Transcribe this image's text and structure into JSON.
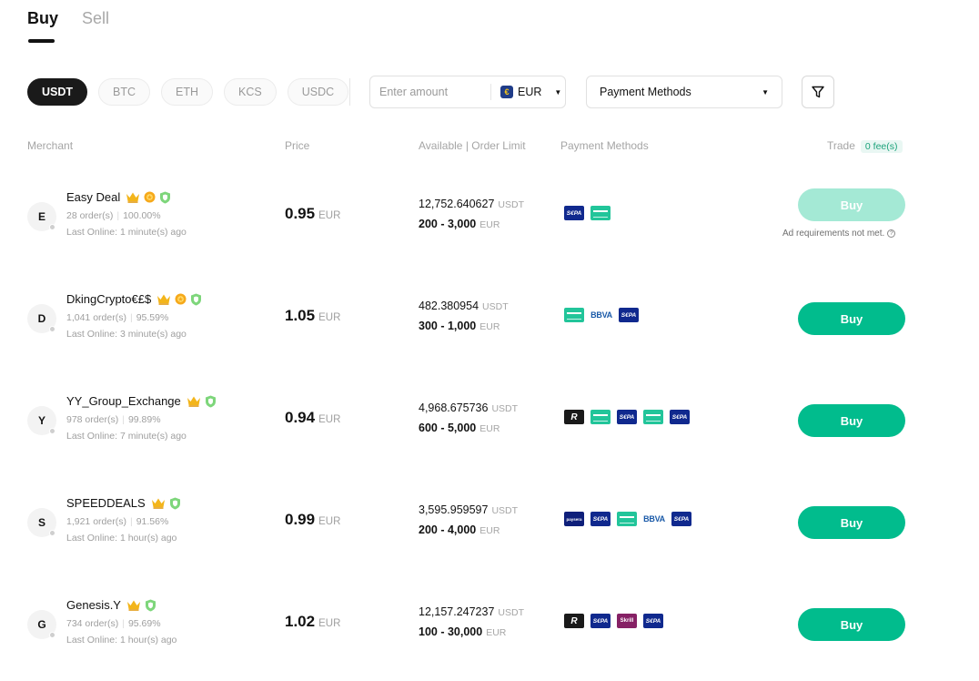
{
  "tabs": [
    {
      "label": "Buy",
      "active": true
    },
    {
      "label": "Sell",
      "active": false
    }
  ],
  "coins": [
    {
      "label": "USDT",
      "active": true
    },
    {
      "label": "BTC",
      "active": false
    },
    {
      "label": "ETH",
      "active": false
    },
    {
      "label": "KCS",
      "active": false
    },
    {
      "label": "USDC",
      "active": false
    }
  ],
  "amount": {
    "placeholder": "Enter amount",
    "value": "",
    "currency": "EUR",
    "currency_icon": "€"
  },
  "payment_filter": {
    "label": "Payment Methods"
  },
  "table": {
    "headers": {
      "merchant": "Merchant",
      "price": "Price",
      "available": "Available | Order Limit",
      "payment": "Payment Methods",
      "trade": "Trade",
      "fee": "0 fee(s)"
    },
    "rows": [
      {
        "initial": "E",
        "name": "Easy Deal",
        "badges": [
          "crown",
          "gold",
          "shield"
        ],
        "orders": "28 order(s)",
        "rate": "100.00%",
        "online": "Last Online: 1 minute(s) ago",
        "price": "0.95",
        "price_cur": "EUR",
        "available": "12,752.640627",
        "available_unit": "USDT",
        "limit": "200 - 3,000",
        "limit_unit": "EUR",
        "payments": [
          {
            "type": "sepa",
            "label": "S€PA"
          },
          {
            "type": "card",
            "label": ""
          }
        ],
        "buy_label": "Buy",
        "disabled": true,
        "note": "Ad requirements not met."
      },
      {
        "initial": "D",
        "name": "DkingCrypto€£$",
        "badges": [
          "crown",
          "gold",
          "shield"
        ],
        "orders": "1,041 order(s)",
        "rate": "95.59%",
        "online": "Last Online: 3 minute(s) ago",
        "price": "1.05",
        "price_cur": "EUR",
        "available": "482.380954",
        "available_unit": "USDT",
        "limit": "300 - 1,000",
        "limit_unit": "EUR",
        "payments": [
          {
            "type": "card",
            "label": ""
          },
          {
            "type": "bbva",
            "label": "BBVA"
          },
          {
            "type": "sepa",
            "label": "S€PA"
          }
        ],
        "buy_label": "Buy",
        "disabled": false,
        "note": ""
      },
      {
        "initial": "Y",
        "name": "YY_Group_Exchange",
        "badges": [
          "crown",
          "shield"
        ],
        "orders": "978 order(s)",
        "rate": "99.89%",
        "online": "Last Online: 7 minute(s) ago",
        "price": "0.94",
        "price_cur": "EUR",
        "available": "4,968.675736",
        "available_unit": "USDT",
        "limit": "600 - 5,000",
        "limit_unit": "EUR",
        "payments": [
          {
            "type": "revolut",
            "label": "R"
          },
          {
            "type": "card",
            "label": ""
          },
          {
            "type": "sepa",
            "label": "S€PA"
          },
          {
            "type": "card",
            "label": ""
          },
          {
            "type": "sepa",
            "label": "S€PA"
          }
        ],
        "buy_label": "Buy",
        "disabled": false,
        "note": ""
      },
      {
        "initial": "S",
        "name": "SPEEDDEALS",
        "badges": [
          "crown",
          "shield"
        ],
        "orders": "1,921 order(s)",
        "rate": "91.56%",
        "online": "Last Online: 1 hour(s) ago",
        "price": "0.99",
        "price_cur": "EUR",
        "available": "3,595.959597",
        "available_unit": "USDT",
        "limit": "200 - 4,000",
        "limit_unit": "EUR",
        "payments": [
          {
            "type": "paysera",
            "label": "paysera"
          },
          {
            "type": "sepa",
            "label": "S€PA"
          },
          {
            "type": "card",
            "label": ""
          },
          {
            "type": "bbva",
            "label": "BBVA"
          },
          {
            "type": "sepa",
            "label": "S€PA"
          }
        ],
        "buy_label": "Buy",
        "disabled": false,
        "note": ""
      },
      {
        "initial": "G",
        "name": "Genesis.Y",
        "badges": [
          "crown",
          "shield"
        ],
        "orders": "734 order(s)",
        "rate": "95.69%",
        "online": "Last Online: 1 hour(s) ago",
        "price": "1.02",
        "price_cur": "EUR",
        "available": "12,157.247237",
        "available_unit": "USDT",
        "limit": "100 - 30,000",
        "limit_unit": "EUR",
        "payments": [
          {
            "type": "revolut",
            "label": "R"
          },
          {
            "type": "sepa",
            "label": "S€PA"
          },
          {
            "type": "skrill",
            "label": "Skrill"
          },
          {
            "type": "sepa",
            "label": "S€PA"
          }
        ],
        "buy_label": "Buy",
        "disabled": false,
        "note": ""
      }
    ]
  }
}
